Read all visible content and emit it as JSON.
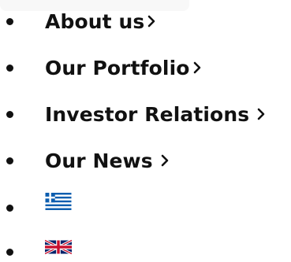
{
  "menu": {
    "items": [
      {
        "label": "About us",
        "icon": "chevron-right-icon"
      },
      {
        "label": "Our Portfolio",
        "icon": "chevron-right-icon"
      },
      {
        "label": "Investor Relations",
        "icon": "chevron-right-icon"
      },
      {
        "label": "Our News",
        "icon": "chevron-right-icon"
      }
    ],
    "languages": [
      {
        "icon": "greek-flag-icon"
      },
      {
        "icon": "uk-flag-icon"
      }
    ]
  },
  "colors": {
    "text": "#111111",
    "greece_blue": "#0d5eaf",
    "uk_blue": "#012169",
    "uk_red": "#c8102e"
  }
}
